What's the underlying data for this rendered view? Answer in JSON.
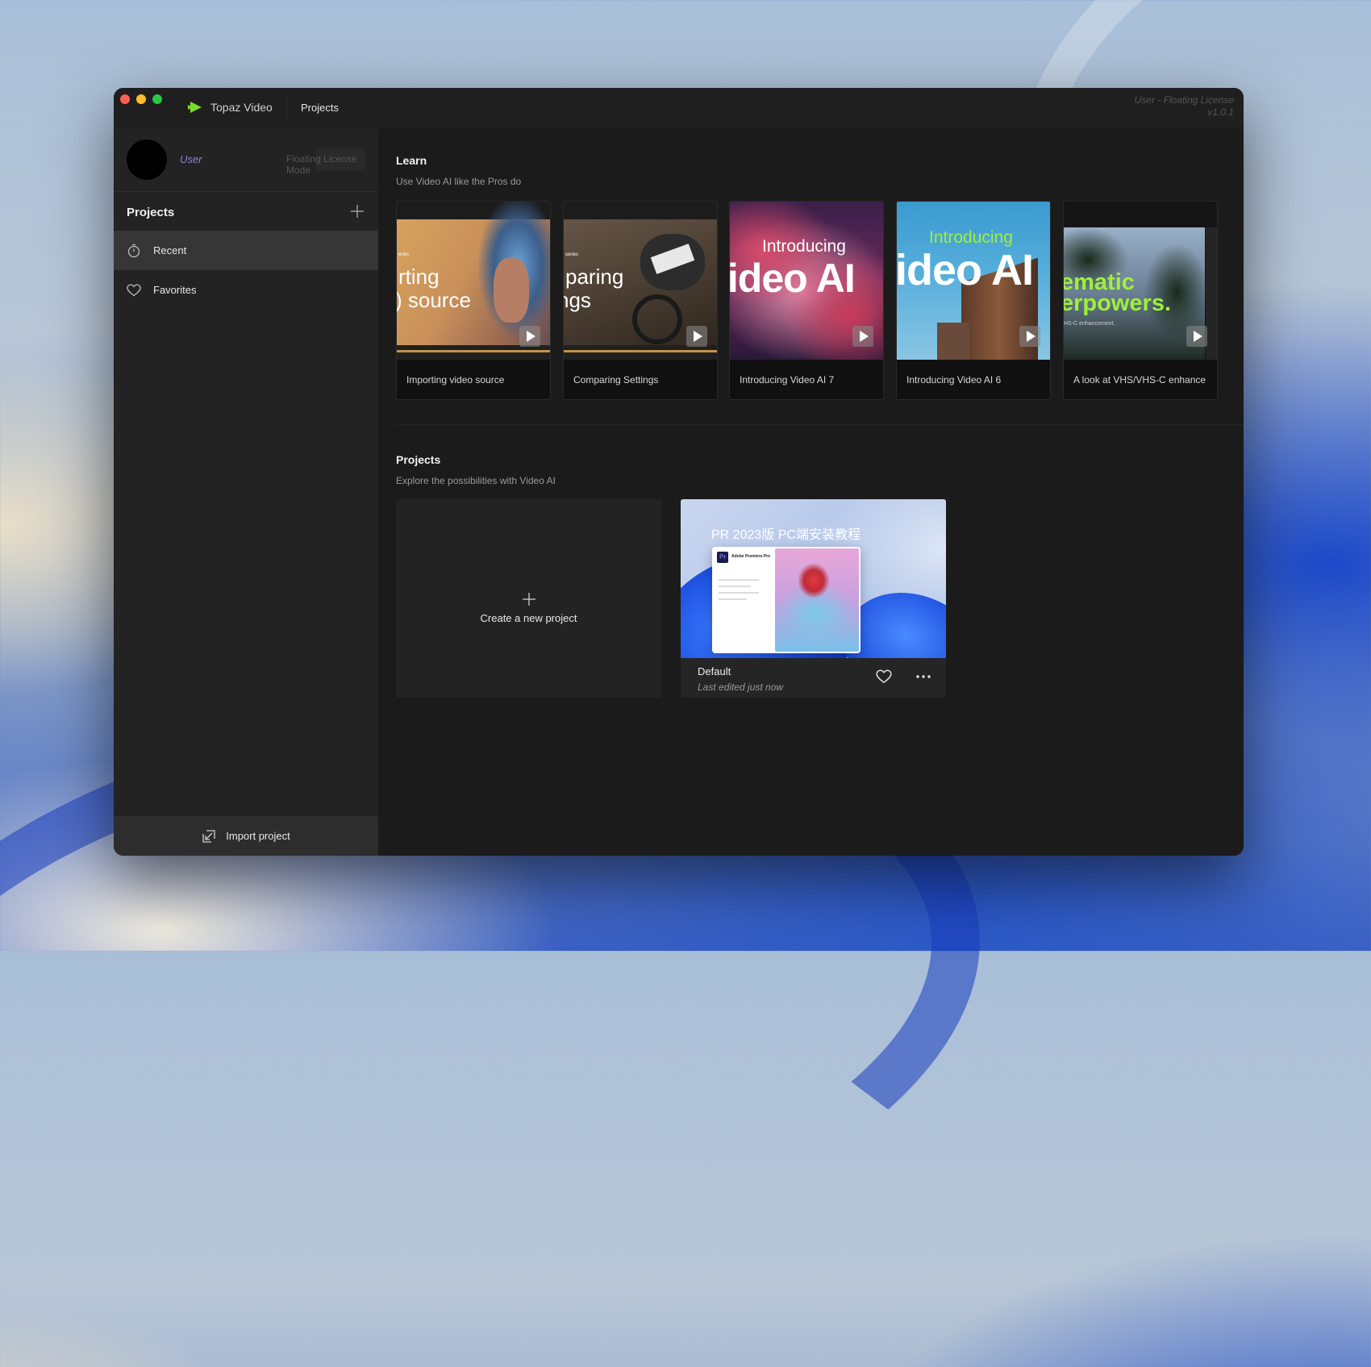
{
  "window": {
    "app_name": "Topaz Video",
    "title_tab": "Projects",
    "license_line1": "User - Floating License",
    "license_line2": "v1.0.1"
  },
  "user": {
    "name": "User",
    "mode": "Floating License Mode"
  },
  "sidebar": {
    "heading": "Projects",
    "items": [
      {
        "label": "Recent",
        "icon": "stopwatch-icon",
        "active": true
      },
      {
        "label": "Favorites",
        "icon": "heart-icon",
        "active": false
      }
    ],
    "import_label": "Import project"
  },
  "learn": {
    "title": "Learn",
    "subtitle": "Use Video AI like the Pros do",
    "cards": [
      {
        "caption": "Importing video source",
        "thumb_l1": "rting",
        "thumb_l2": ") source",
        "thumb_small": "eries"
      },
      {
        "caption": "Comparing Settings",
        "thumb_l1": "paring",
        "thumb_l2": "ngs",
        "thumb_small": "series"
      },
      {
        "caption": "Introducing Video AI 7",
        "thumb_l1": "Introducing",
        "thumb_l2": "/ideo AI"
      },
      {
        "caption": "Introducing Video AI 6",
        "thumb_l1": "Introducing",
        "thumb_l2": "/ideo AI"
      },
      {
        "caption": "A look at VHS/VHS-C enhance",
        "thumb_l1": "ematic",
        "thumb_l2": "erpowers.",
        "thumb_small": "HS-C enhancement."
      }
    ]
  },
  "projects": {
    "title": "Projects",
    "subtitle": "Explore the possibilities with Video AI",
    "new_label": "Create a new project",
    "items": [
      {
        "name": "Default",
        "time": "Last edited just now",
        "thumb_title": "PR 2023版 PC端安装教程",
        "thumb_app": "Adobe Premiere Pro",
        "thumb_badge": "Pr"
      }
    ]
  },
  "colors": {
    "accent_green": "#7cdc2a",
    "user_purple": "#8e86d8",
    "traffic_red": "#ff5f57",
    "traffic_yellow": "#febc2e",
    "traffic_green": "#28c840"
  }
}
